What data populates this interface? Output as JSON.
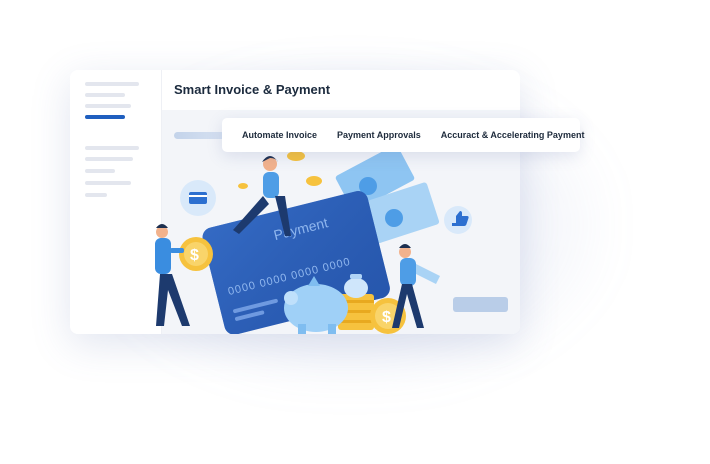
{
  "window": {
    "title": "Smart Invoice & Payment"
  },
  "tabs": [
    {
      "label": "Automate Invoice"
    },
    {
      "label": "Payment Approvals"
    },
    {
      "label": "Accuract & Accelerating Payment"
    }
  ],
  "illustration": {
    "card_label": "Payment",
    "card_number": "0000 0000 0000 0000"
  },
  "colors": {
    "accent": "#1f5fbf",
    "card": "#2c5fb8",
    "coin": "#f6c23e",
    "light_blue": "#8ec5f2"
  }
}
